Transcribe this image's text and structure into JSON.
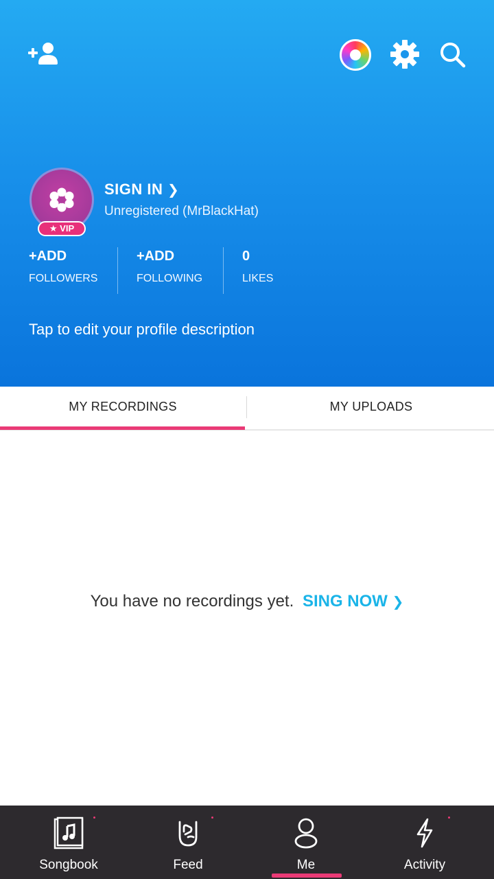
{
  "header": {
    "sign_in_label": "SIGN IN",
    "username": "Unregistered (MrBlackHat)",
    "vip_label": "VIP",
    "profile_description": "Tap to edit your profile description"
  },
  "stats": [
    {
      "value": "+ADD",
      "label": "FOLLOWERS"
    },
    {
      "value": "+ADD",
      "label": "FOLLOWING"
    },
    {
      "value": "0",
      "label": "LIKES"
    }
  ],
  "tabs": [
    {
      "label": "MY RECORDINGS",
      "selected": true
    },
    {
      "label": "MY UPLOADS",
      "selected": false
    }
  ],
  "empty_state": {
    "message": "You have no recordings yet.",
    "action": "SING NOW"
  },
  "bottom_nav": [
    {
      "label": "Songbook",
      "icon": "songbook-icon"
    },
    {
      "label": "Feed",
      "icon": "rock-hand-icon"
    },
    {
      "label": "Me",
      "icon": "person-icon",
      "selected": true
    },
    {
      "label": "Activity",
      "icon": "lightning-icon"
    }
  ],
  "colors": {
    "header_top": "#24aaf2",
    "header_bottom": "#0a74dc",
    "accent_pink": "#ea3a76",
    "link_blue": "#1ab4e8",
    "nav_bg": "#2d2a2e"
  }
}
